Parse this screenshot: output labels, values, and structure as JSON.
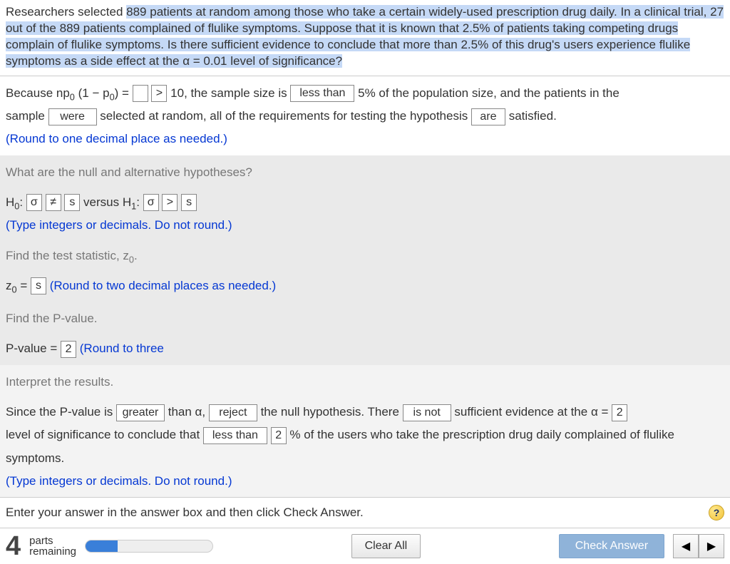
{
  "question": {
    "pre": "Researchers selected ",
    "n": "889",
    "mid1": " patients at random among those who take a certain widely-used prescription drug daily. In a clinical trial, ",
    "x": "27",
    "mid2": " out of the ",
    "n2": "889",
    "mid3": " patients complained of flulike symptoms. Suppose that it is known that ",
    "pct": "2.5%",
    "mid4": " of patients taking competing drugs complain of flulike symptoms. Is there sufficient evidence to conclude that more than ",
    "pct2": "2.5%",
    "mid5": " of this drug's users experience flulike symptoms as a side effect at the α = ",
    "alpha": "0.01",
    "tail": " level of significance?"
  },
  "line1": {
    "t1": "Because np",
    "t2": " (1 − p",
    "t3": ") = ",
    "gt": ">",
    "ten": "10, the sample size is",
    "sel1": "less than",
    "t4": "5% of the population size, and the patients in the",
    "t5": "sample",
    "sel2": "were",
    "t6": "selected at random, all of the requirements for testing the hypothesis",
    "sel3": "are",
    "t7": "satisfied.",
    "note": "(Round to one decimal place as needed.)"
  },
  "hyp": {
    "title": "What are the null and alternative hypotheses?",
    "h0": "H",
    "colon": ":",
    "sel_a": "σ",
    "sel_b": "≠",
    "val_b": "s",
    "vs": " versus H",
    "sel_c": "σ",
    "sel_d": ">",
    "val_d": "s",
    "note": "(Type integers or decimals. Do not round.)"
  },
  "z": {
    "title": "Find the test statistic, z",
    "lab": "z",
    "eq": " = ",
    "val": "s",
    "note": "(Round to two decimal places as needed.)"
  },
  "pv": {
    "title": "Find the P-value.",
    "lab": "P-value = ",
    "val": "2",
    "note": "(Round to three"
  },
  "interp": {
    "title": "Interpret the results.",
    "t1": "Since the P-value is",
    "sel1": "greater",
    "t2": "than α,",
    "sel2": "reject",
    "t3": "the null hypothesis. There",
    "sel3": "is not",
    "t4": "sufficient evidence at the α =",
    "val_a": "2",
    "t5": "level of significance to conclude that",
    "sel4": "less than",
    "val_b": "2",
    "t6": "% of the users who take the prescription drug daily complained of flulike",
    "t7": "symptoms.",
    "note": "(Type integers or decimals. Do not round.)"
  },
  "entry": "Enter your answer in the answer box and then click Check Answer.",
  "footer": {
    "num": "4",
    "l1": "parts",
    "l2": "remaining",
    "clear": "Clear All",
    "check": "Check Answer"
  }
}
